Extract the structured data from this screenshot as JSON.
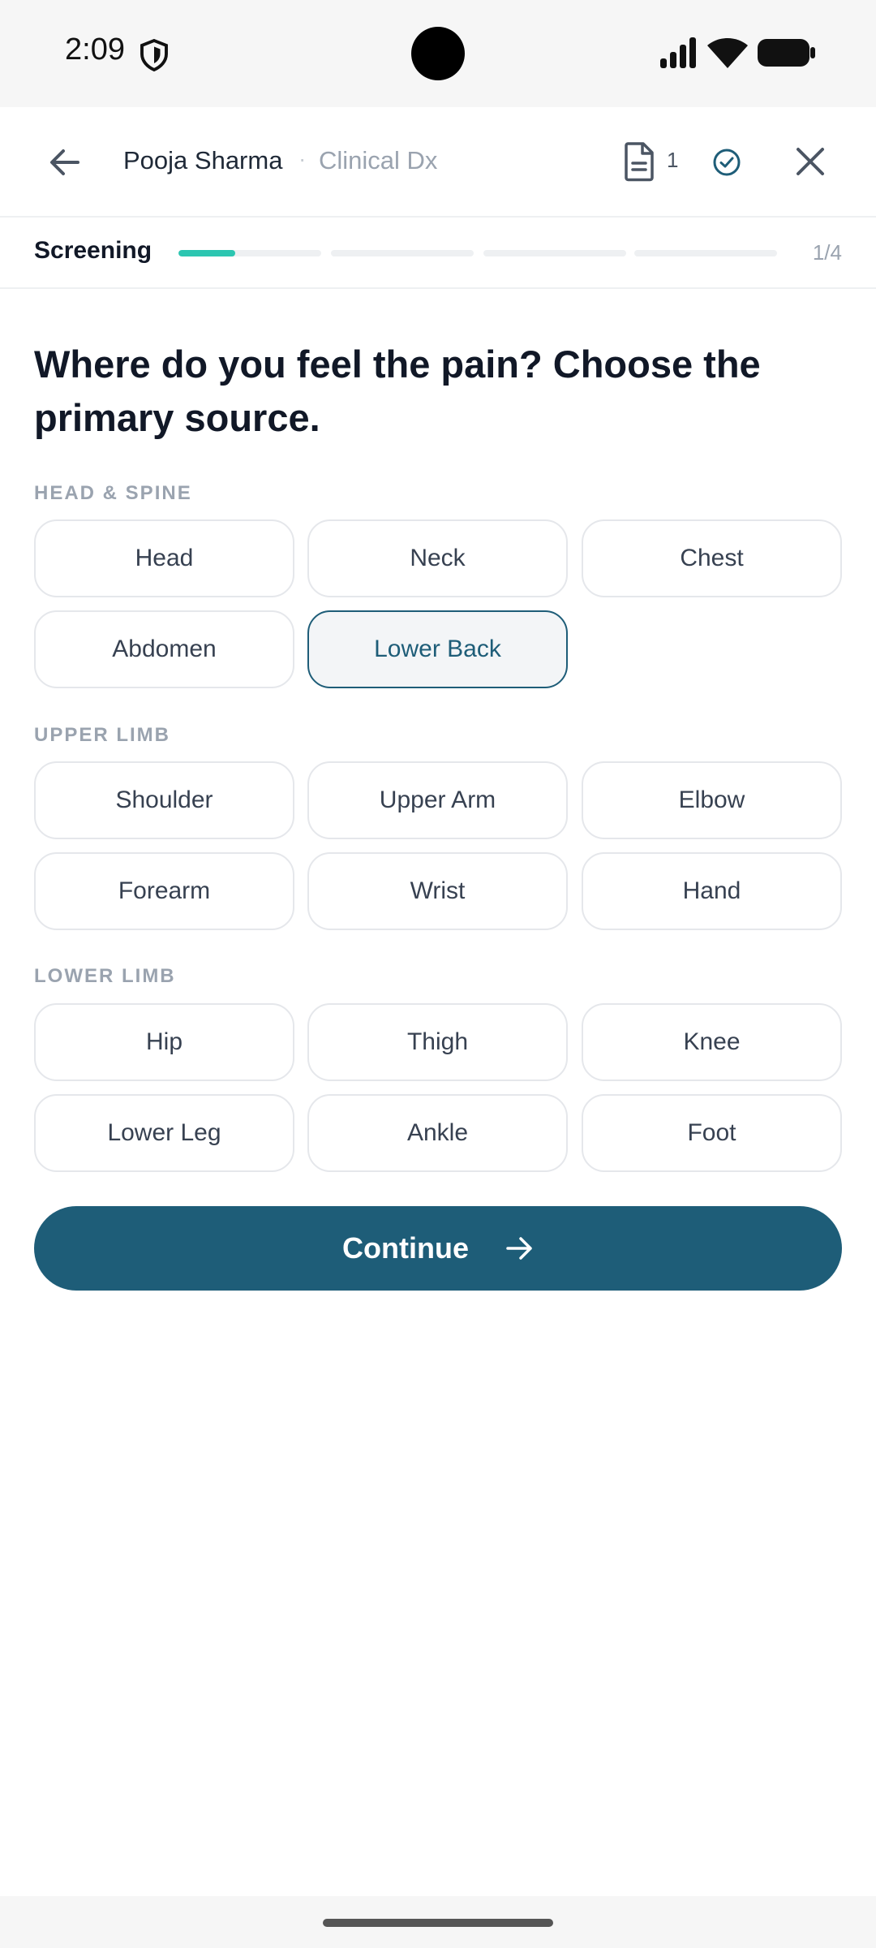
{
  "status_bar": {
    "time": "2:09"
  },
  "header": {
    "patient_name": "Pooja Sharma",
    "separator": "·",
    "context": "Clinical Dx",
    "document_count": "1"
  },
  "progress": {
    "label": "Screening",
    "count": "1/4",
    "current_step_fill": 0.4
  },
  "question": "Where do you feel the pain? Choose the primary source.",
  "sections": [
    {
      "label": "HEAD & SPINE",
      "options": [
        "Head",
        "Neck",
        "Chest",
        "Abdomen",
        "Lower Back"
      ]
    },
    {
      "label": "UPPER LIMB",
      "options": [
        "Shoulder",
        "Upper Arm",
        "Elbow",
        "Forearm",
        "Wrist",
        "Hand"
      ]
    },
    {
      "label": "LOWER LIMB",
      "options": [
        "Hip",
        "Thigh",
        "Knee",
        "Lower Leg",
        "Ankle",
        "Foot"
      ]
    }
  ],
  "selected_option": "Lower Back",
  "continue_label": "Continue",
  "colors": {
    "accent": "#1e5d78",
    "progress": "#2cc6b1"
  }
}
